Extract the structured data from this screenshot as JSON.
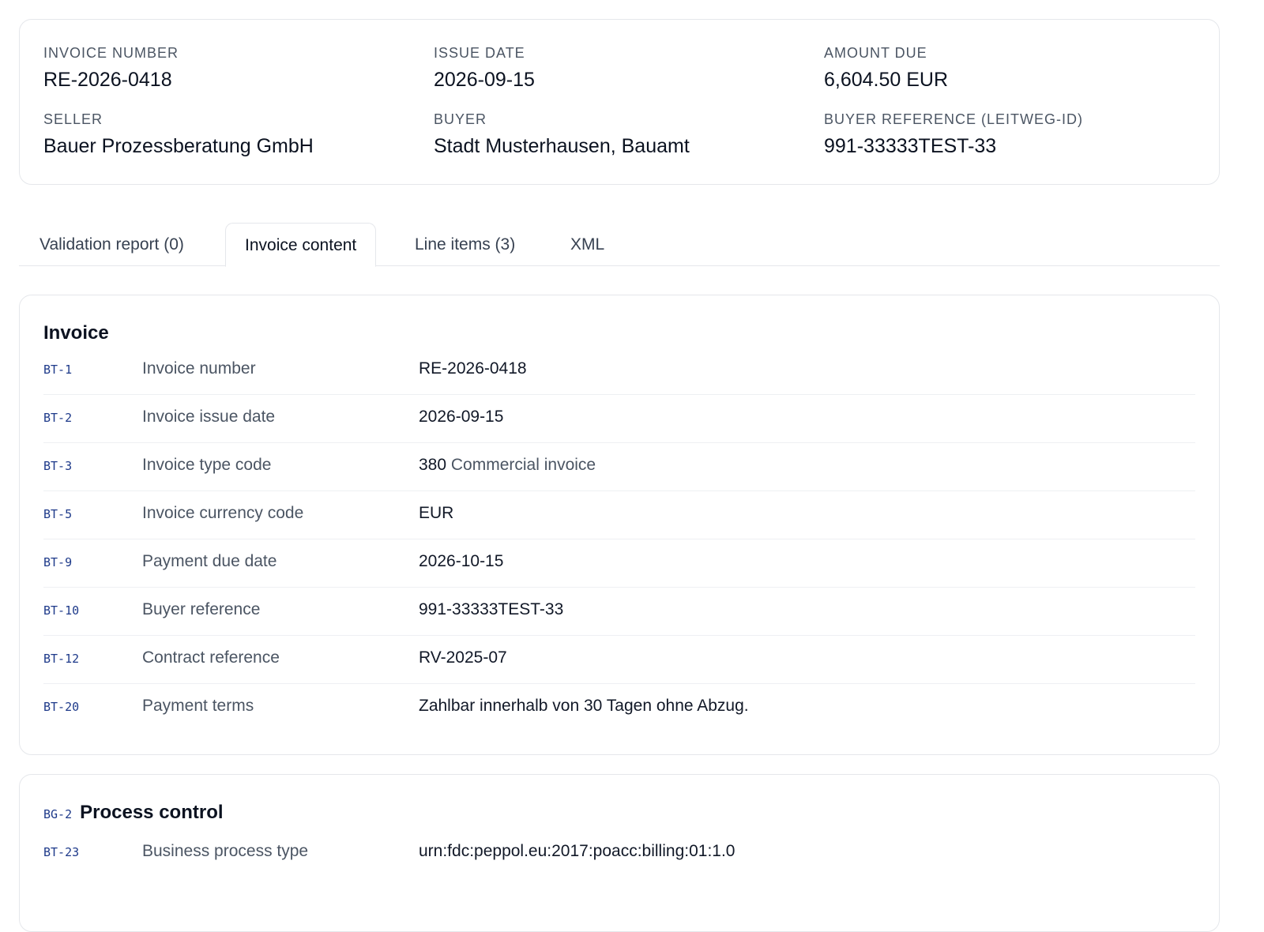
{
  "summary": {
    "invoice_number_label": "INVOICE NUMBER",
    "invoice_number": "RE-2026-0418",
    "issue_date_label": "ISSUE DATE",
    "issue_date": "2026-09-15",
    "amount_due_label": "AMOUNT DUE",
    "amount_due": "6,604.50 EUR",
    "seller_label": "SELLER",
    "seller": "Bauer Prozessberatung GmbH",
    "buyer_label": "BUYER",
    "buyer": "Stadt Musterhausen, Bauamt",
    "buyer_reference_label": "BUYER REFERENCE (LEITWEG-ID)",
    "buyer_reference": "991-33333TEST-33"
  },
  "tabs": [
    {
      "label": "Validation report (0)",
      "active": false
    },
    {
      "label": "Invoice content",
      "active": true
    },
    {
      "label": "Line items (3)",
      "active": false
    },
    {
      "label": "XML",
      "active": false
    }
  ],
  "invoice_section": {
    "title": "Invoice",
    "rows": [
      {
        "code": "BT-1",
        "field": "Invoice number",
        "value": "RE-2026-0418",
        "sub": ""
      },
      {
        "code": "BT-2",
        "field": "Invoice issue date",
        "value": "2026-09-15",
        "sub": ""
      },
      {
        "code": "BT-3",
        "field": "Invoice type code",
        "value": "380",
        "sub": "Commercial invoice"
      },
      {
        "code": "BT-5",
        "field": "Invoice currency code",
        "value": "EUR",
        "sub": ""
      },
      {
        "code": "BT-9",
        "field": "Payment due date",
        "value": "2026-10-15",
        "sub": ""
      },
      {
        "code": "BT-10",
        "field": "Buyer reference",
        "value": "991-33333TEST-33",
        "sub": ""
      },
      {
        "code": "BT-12",
        "field": "Contract reference",
        "value": "RV-2025-07",
        "sub": ""
      },
      {
        "code": "BT-20",
        "field": "Payment terms",
        "value": "Zahlbar innerhalb von 30 Tagen ohne Abzug.",
        "sub": ""
      }
    ]
  },
  "process_section": {
    "code": "BG-2",
    "title": "Process control",
    "rows": [
      {
        "code": "BT-23",
        "field": "Business process type",
        "value": "urn:fdc:peppol.eu:2017:poacc:billing:01:1.0"
      }
    ]
  }
}
